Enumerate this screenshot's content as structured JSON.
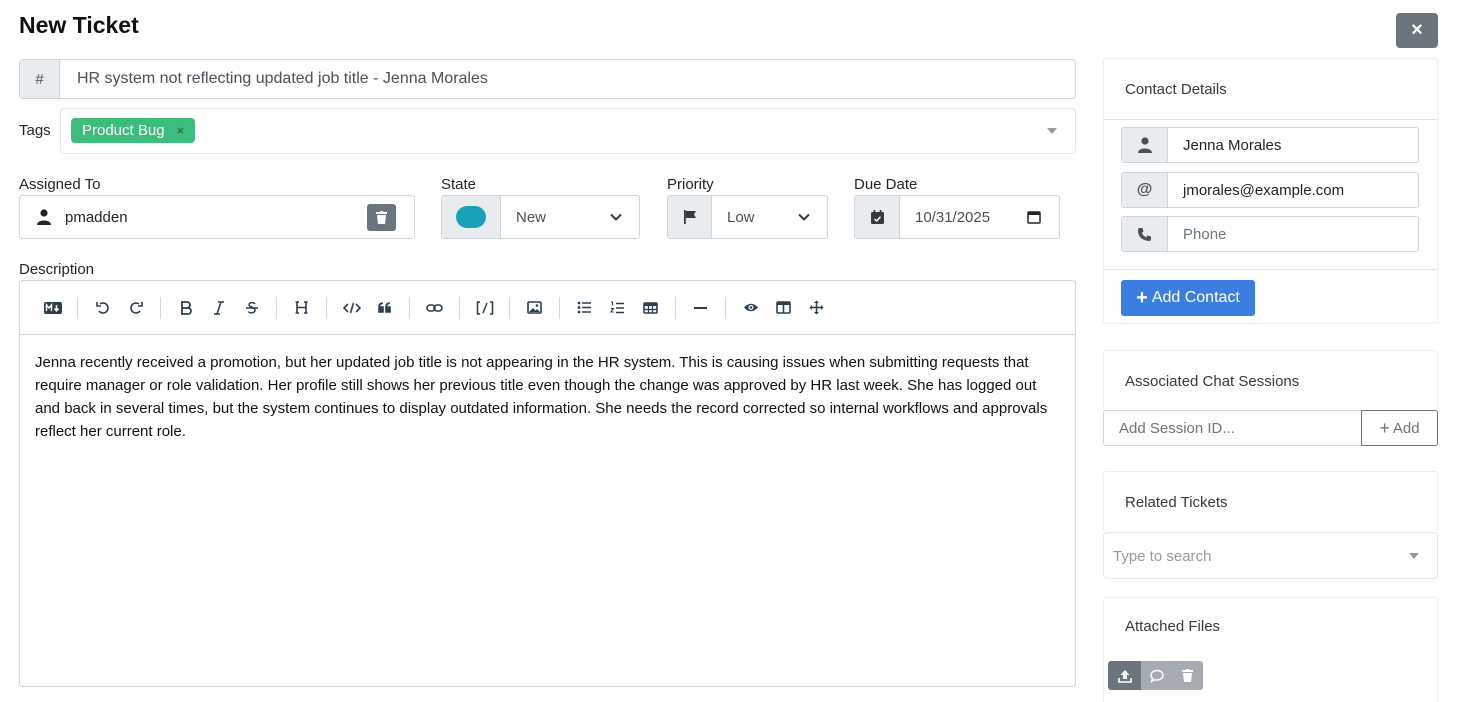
{
  "page": {
    "title": "New Ticket",
    "close_label": "×"
  },
  "subject": {
    "prefix": "#",
    "value": "HR system not reflecting updated job title - Jenna Morales"
  },
  "tags": {
    "label": "Tags",
    "items": [
      {
        "label": "Product Bug",
        "remove": "×",
        "color": "#3dbd7d"
      }
    ]
  },
  "assigned": {
    "label": "Assigned To",
    "value": "pmadden"
  },
  "state": {
    "label": "State",
    "value": "New",
    "color": "#17a2b8"
  },
  "priority": {
    "label": "Priority",
    "value": "Low"
  },
  "due_date": {
    "label": "Due Date",
    "value": "10/31/2025"
  },
  "description": {
    "label": "Description",
    "toolbar": [
      "markdown-icon",
      "undo-icon",
      "redo-icon",
      "bold-icon",
      "italic-icon",
      "strikethrough-icon",
      "heading-icon",
      "code-icon",
      "quote-icon",
      "link-icon",
      "code-block-icon",
      "image-icon",
      "unordered-list-icon",
      "ordered-list-icon",
      "table-icon",
      "horizontal-rule-icon",
      "preview-icon",
      "side-by-side-icon",
      "fullscreen-icon"
    ],
    "body": "Jenna recently received a promotion, but her updated job title is not appearing in the HR system. This is causing issues when submitting requests that require manager or role validation. Her profile still shows her previous title even though the change was approved by HR last week. She has logged out and back in several times, but the system continues to display outdated information. She needs the record corrected so internal workflows and approvals reflect her current role."
  },
  "contact": {
    "title": "Contact Details",
    "name": "Jenna Morales",
    "email_prefix": "@",
    "email": "jmorales@example.com",
    "phone_placeholder": "Phone",
    "add_label": "Add Contact"
  },
  "chat": {
    "title": "Associated Chat Sessions",
    "placeholder": "Add Session ID...",
    "add_label": "Add"
  },
  "related": {
    "title": "Related Tickets",
    "placeholder": "Type to search"
  },
  "files": {
    "title": "Attached Files"
  },
  "colors": {
    "accent": "#3a7ee0",
    "secondary": "#6c757d",
    "tag": "#3dbd7d",
    "state": "#17a2b8"
  }
}
